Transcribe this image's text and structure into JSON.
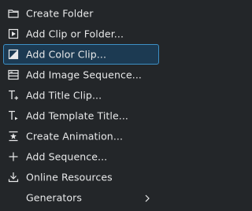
{
  "menu": {
    "items": [
      {
        "label": "Create Folder",
        "icon": "folder-new-icon"
      },
      {
        "label": "Add Clip or Folder...",
        "icon": "add-clip-icon"
      },
      {
        "label": "Add Color Clip...",
        "icon": "color-clip-icon"
      },
      {
        "label": "Add Image Sequence...",
        "icon": "image-sequence-icon"
      },
      {
        "label": "Add Title Clip...",
        "icon": "title-clip-icon"
      },
      {
        "label": "Add Template Title...",
        "icon": "template-title-icon"
      },
      {
        "label": "Create Animation...",
        "icon": "animation-icon"
      },
      {
        "label": "Add Sequence...",
        "icon": "plus-icon"
      },
      {
        "label": "Online Resources",
        "icon": "download-icon"
      },
      {
        "label": "Generators",
        "icon": "",
        "submenu": true
      }
    ],
    "highlighted_index": 2
  },
  "colors": {
    "background": "#232629",
    "text": "#e8e9ea",
    "highlight_fill": "#1c3a52",
    "highlight_border": "#3d8fc4"
  }
}
